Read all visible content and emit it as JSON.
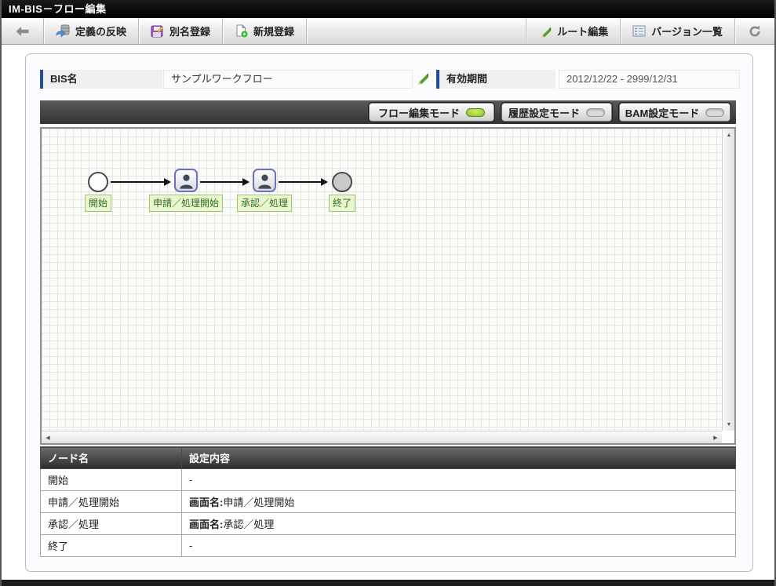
{
  "window": {
    "title": "IM-BIS－フロー編集"
  },
  "toolbar": {
    "reflect_definition": "定義の反映",
    "alias_register": "別名登録",
    "new_register": "新規登録",
    "route_edit": "ルート編集",
    "version_list": "バージョン一覧"
  },
  "fields": {
    "bis_name_label": "BIS名",
    "bis_name_value": "サンプルワークフロー",
    "valid_period_label": "有効期間",
    "valid_period_value": "2012/12/22 - 2999/12/31"
  },
  "modes": [
    {
      "label": "フロー編集モード",
      "active": true
    },
    {
      "label": "履歴設定モード",
      "active": false
    },
    {
      "label": "BAM設定モード",
      "active": false
    }
  ],
  "flow": {
    "nodes": [
      {
        "type": "start",
        "label": "開始"
      },
      {
        "type": "task",
        "label": "申請／処理開始"
      },
      {
        "type": "task",
        "label": "承認／処理"
      },
      {
        "type": "end",
        "label": "終了"
      }
    ]
  },
  "table": {
    "headers": [
      "ノード名",
      "設定内容"
    ],
    "rows": [
      {
        "node": "開始",
        "prefix": "",
        "value": "-"
      },
      {
        "node": "申請／処理開始",
        "prefix": "画面名:",
        "value": "申請／処理開始"
      },
      {
        "node": "承認／処理",
        "prefix": "画面名:",
        "value": "承認／処理"
      },
      {
        "node": "終了",
        "prefix": "",
        "value": "-"
      }
    ]
  },
  "colors": {
    "active_led": "#8cc222",
    "inactive_led": "#dadada",
    "accent_blue": "#1e4e9a",
    "node_label_bg": "#eaf6cf",
    "node_label_border": "#a3c46a",
    "node_label_text": "#2f6d1f",
    "table_header_bg": "#3d3d3d"
  }
}
